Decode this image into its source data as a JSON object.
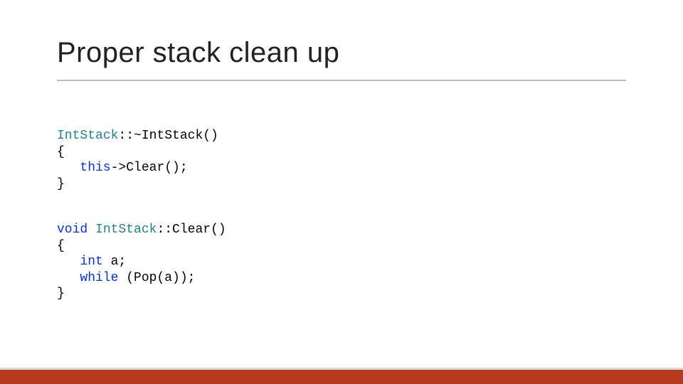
{
  "title": "Proper stack clean up",
  "code1": {
    "l1a": "IntStack",
    "l1b": "::~IntStack()",
    "l2": "{",
    "l3_indent": "   ",
    "l3_kw": "this",
    "l3_rest": "->Clear();",
    "l4": "}"
  },
  "code2": {
    "l1_kw": "void",
    "l1_sp": " ",
    "l1_type": "IntStack",
    "l1_rest": "::Clear()",
    "l2": "{",
    "l3_indent": "   ",
    "l3_kw": "int",
    "l3_rest": " a;",
    "l4_indent": "   ",
    "l4_kw": "while",
    "l4_rest": " (Pop(a));",
    "l5": "}"
  }
}
